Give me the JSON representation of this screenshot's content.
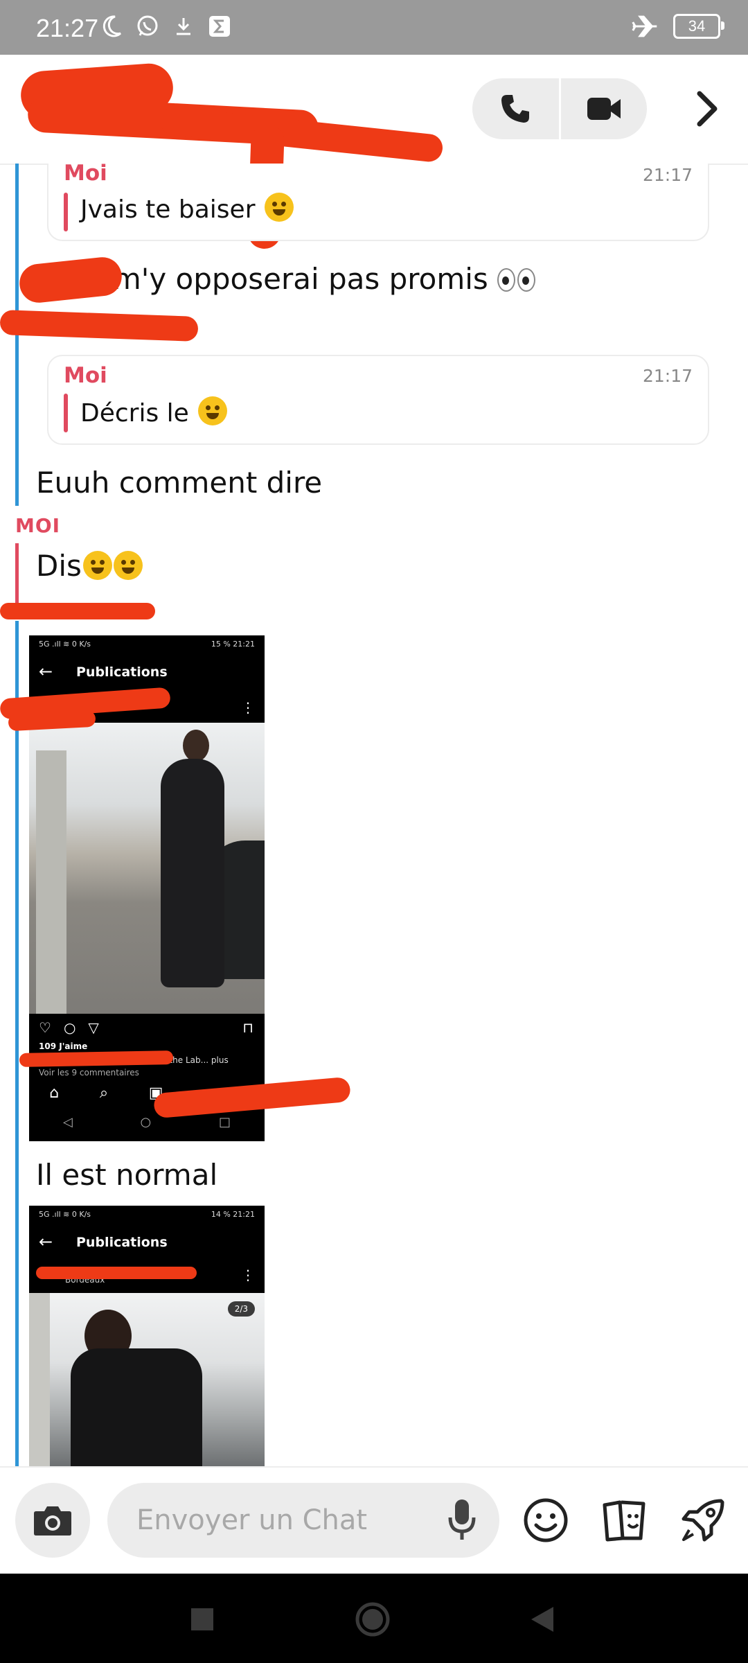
{
  "status_bar": {
    "time": "21:27",
    "battery": "34",
    "icons": [
      "moon-icon",
      "whatsapp-icon",
      "download-icon",
      "sigma-icon",
      "airplane-mode-icon",
      "battery-icon"
    ]
  },
  "header": {
    "contact_name": "",
    "call_button_icon": "phone-icon",
    "video_button_icon": "video-camera-icon",
    "more_icon": "chevron-right-icon"
  },
  "messages": {
    "m1": {
      "quoted_sender": "Moi",
      "quoted_time": "21:17",
      "quoted_text": "Jvais te baiser"
    },
    "m2": {
      "text": "je m'y opposerai pas promis"
    },
    "m3": {
      "quoted_sender": "Moi",
      "quoted_time": "21:17",
      "quoted_text": "Décris le"
    },
    "m4": {
      "text": "Euuh comment dire"
    },
    "m5": {
      "sender": "MOI",
      "text": "Dis"
    },
    "m6": {
      "screenshot": {
        "status_left": "5G .ıll ≋ 0 K/s",
        "status_right": "15 % 21:21",
        "title": "Publications",
        "likes": "109 J'aime",
        "caption": "Straight up from the Lab... plus",
        "comments": "Voir les 9 commentaires"
      }
    },
    "m7": {
      "text": "Il est normal"
    },
    "m8": {
      "screenshot": {
        "status_left": "5G .ıll ≋ 0 K/s",
        "status_right": "14 % 21:21",
        "title": "Publications",
        "location": "Bordeaux",
        "counter": "2/3"
      }
    }
  },
  "input": {
    "placeholder": "Envoyer un Chat",
    "camera_icon": "camera-icon",
    "mic_icon": "microphone-icon",
    "emoji_icon": "smiley-icon",
    "stickers_icon": "stickers-icon",
    "games_icon": "rocket-icon"
  },
  "colors": {
    "accent_red": "#e04a5f",
    "accent_blue": "#2f95d6",
    "redaction": "#ee3a16"
  }
}
